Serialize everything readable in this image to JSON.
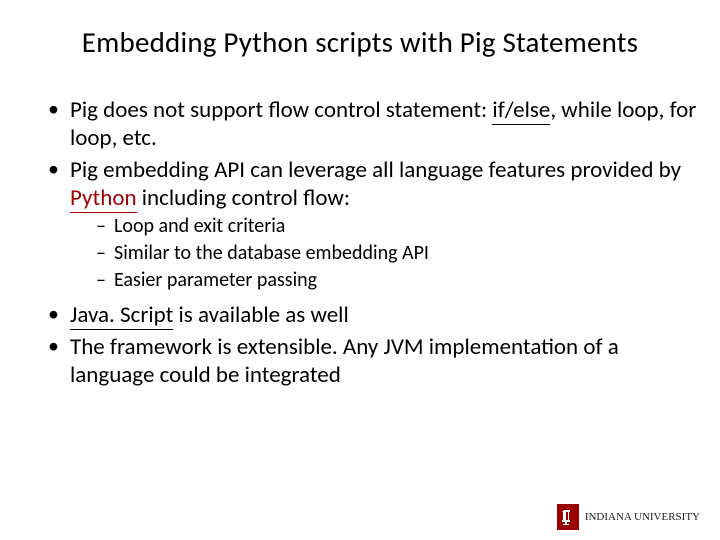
{
  "title": "Embedding Python scripts with Pig Statements",
  "bullets_1a_pre": "Pig does not support flow control statement: ",
  "bullets_1a_ul": "if/else",
  "bullets_1a_post": ", while loop, for loop, etc.",
  "bullets_1b_pre": "Pig embedding API can leverage all language features provided by ",
  "bullets_1b_ul": "Python",
  "bullets_1b_post": " including control flow:",
  "sub_1": "Loop and exit criteria",
  "sub_2": "Similar to the database embedding API",
  "sub_3": "Easier parameter passing",
  "bullets_2a_ul": "Java. Script",
  "bullets_2a_post": " is available as well",
  "bullets_2b": "The framework is extensible. Any JVM implementation of a language could be integrated",
  "logo_text": "INDIANA UNIVERSITY"
}
